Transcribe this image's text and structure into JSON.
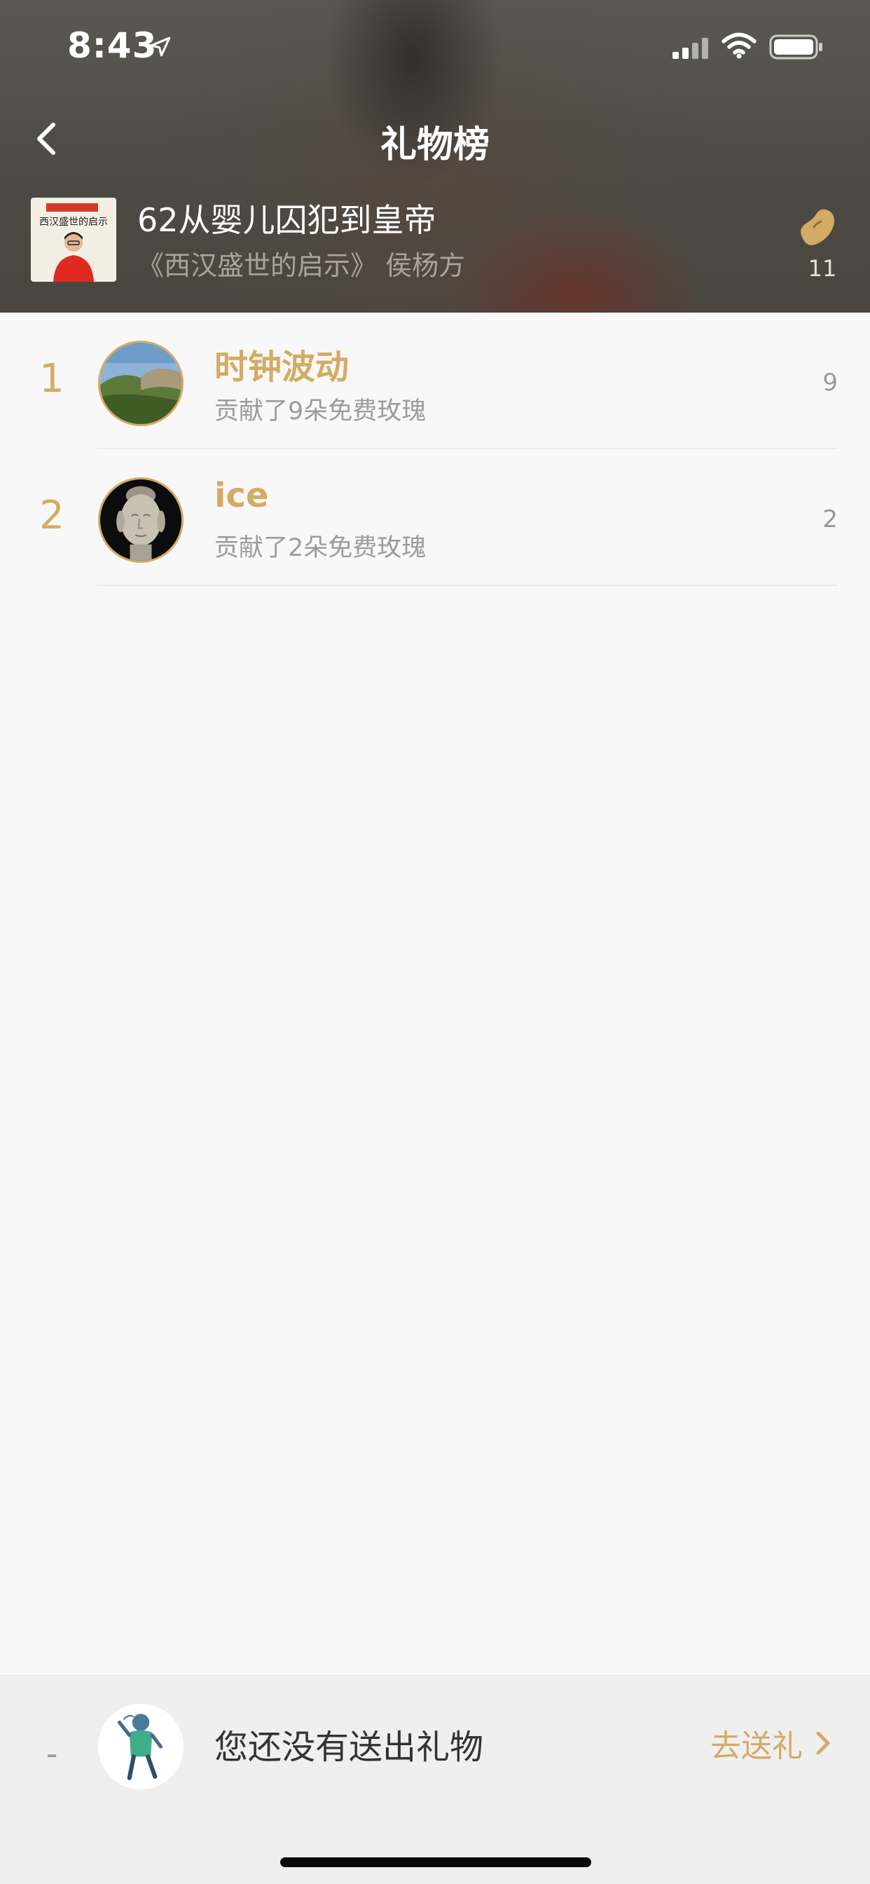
{
  "status": {
    "time": "8:43"
  },
  "nav": {
    "title": "礼物榜"
  },
  "album": {
    "cover_text": "西汉盛世的启示",
    "title": "62从婴儿囚犯到皇帝",
    "subtitle": "《西汉盛世的启示》 侯杨方",
    "bean_count": "11"
  },
  "ranking": [
    {
      "rank": "1",
      "name": "时钟波动",
      "desc": "贡献了9朵免费玫瑰",
      "count": "9",
      "avatar": "landscape-photo"
    },
    {
      "rank": "2",
      "name": "ice",
      "desc": "贡献了2朵免费玫瑰",
      "count": "2",
      "avatar": "buddha-photo"
    }
  ],
  "me": {
    "rank": "-",
    "status": "您还没有送出礼物",
    "action_label": "去送礼"
  },
  "colors": {
    "accent": "#d3ab64",
    "background": "#f8f8f8",
    "bottom_bar": "#efefef",
    "text_secondary": "#9c9c9c"
  }
}
